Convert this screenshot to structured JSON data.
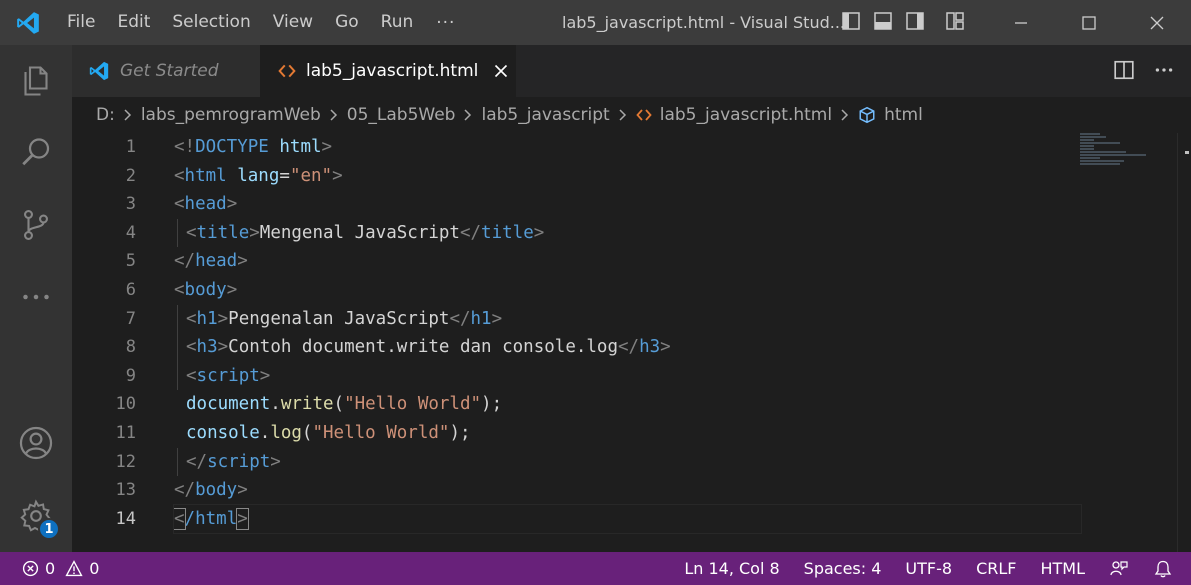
{
  "titlebar": {
    "menu": [
      "File",
      "Edit",
      "Selection",
      "View",
      "Go",
      "Run"
    ],
    "more": "···",
    "window_title": "lab5_javascript.html - Visual Stud..."
  },
  "tabs": [
    {
      "label": "Get Started",
      "active": false,
      "icon": "vscode-logo-icon"
    },
    {
      "label": "lab5_javascript.html",
      "active": true,
      "icon": "html-file-icon"
    }
  ],
  "breadcrumb": {
    "items": [
      "D:",
      "labs_pemrogramWeb",
      "05_Lab5Web",
      "lab5_javascript",
      "lab5_javascript.html",
      "html"
    ]
  },
  "editor": {
    "line_numbers": [
      "1",
      "2",
      "3",
      "4",
      "5",
      "6",
      "7",
      "8",
      "9",
      "10",
      "11",
      "12",
      "13",
      "14"
    ],
    "current_line": 14,
    "lines": {
      "l1": {
        "a": "<!",
        "b": "DOCTYPE",
        "c": " html",
        "d": ">"
      },
      "l2": {
        "a": "<",
        "b": "html",
        "c": " lang",
        "d": "=",
        "e": "\"en\"",
        "f": ">"
      },
      "l3": {
        "a": "<",
        "b": "head",
        "c": ">"
      },
      "l4": {
        "a": "<",
        "b": "title",
        "c": ">",
        "d": "Mengenal JavaScript",
        "e": "</",
        "f": "title",
        "g": ">"
      },
      "l5": {
        "a": "</",
        "b": "head",
        "c": ">"
      },
      "l6": {
        "a": "<",
        "b": "body",
        "c": ">"
      },
      "l7": {
        "a": "<",
        "b": "h1",
        "c": ">",
        "d": "Pengenalan JavaScript",
        "e": "</",
        "f": "h1",
        "g": ">"
      },
      "l8": {
        "a": "<",
        "b": "h3",
        "c": ">",
        "d": "Contoh document.write dan console.log",
        "e": "</",
        "f": "h3",
        "g": ">"
      },
      "l9": {
        "a": "<",
        "b": "script",
        "c": ">"
      },
      "l10": {
        "a": "document",
        "b": ".",
        "c": "write",
        "d": "(",
        "e": "\"Hello World\"",
        "f": ");"
      },
      "l11": {
        "a": "console",
        "b": ".",
        "c": "log",
        "d": "(",
        "e": "\"Hello World\"",
        "f": ");"
      },
      "l12": {
        "a": "</",
        "b": "script",
        "c": ">"
      },
      "l13": {
        "a": "</",
        "b": "body",
        "c": ">"
      },
      "l14": {
        "a": "<",
        "b": "/html",
        "c": ">"
      }
    }
  },
  "statusbar": {
    "errors": "0",
    "warnings": "0",
    "position": "Ln 14, Col 8",
    "spaces": "Spaces: 4",
    "encoding": "UTF-8",
    "eol": "CRLF",
    "language": "HTML"
  },
  "activity": {
    "settings_badge": "1"
  },
  "colors": {
    "statusbar": "#68217a",
    "accent": "#0e70c0",
    "tag": "#569cd6",
    "attribute": "#9cdcfe",
    "string": "#ce9178"
  }
}
